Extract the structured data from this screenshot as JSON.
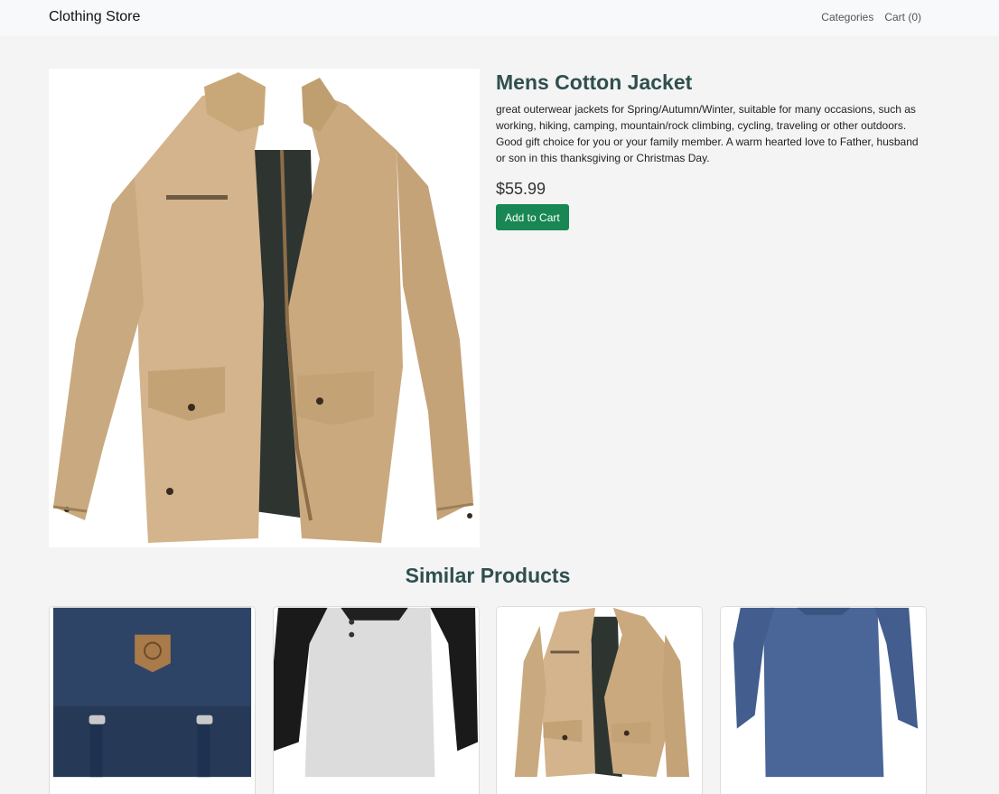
{
  "navbar": {
    "brand": "Clothing Store",
    "links": [
      {
        "label": "Categories"
      },
      {
        "label": "Cart (0)"
      }
    ]
  },
  "product": {
    "image_icon": "jacket-image",
    "title": "Mens Cotton Jacket",
    "description": "great outerwear jackets for Spring/Autumn/Winter, suitable for many occasions, such as working, hiking, camping, mountain/rock climbing, cycling, traveling or other outdoors. Good gift choice for you or your family member. A warm hearted love to Father, husband or son in this thanksgiving or Christmas Day.",
    "price": "$55.99",
    "add_to_cart_label": "Add to Cart"
  },
  "similar": {
    "title": "Similar Products",
    "items": [
      {
        "image_icon": "backpack-image"
      },
      {
        "image_icon": "raglan-shirt-image"
      },
      {
        "image_icon": "jacket-image"
      },
      {
        "image_icon": "long-sleeve-tee-image"
      }
    ]
  },
  "colors": {
    "heading": "#2f4f4f",
    "button": "#198754",
    "navbar_bg": "#f8f9fa",
    "page_bg": "#f4f4f4"
  }
}
